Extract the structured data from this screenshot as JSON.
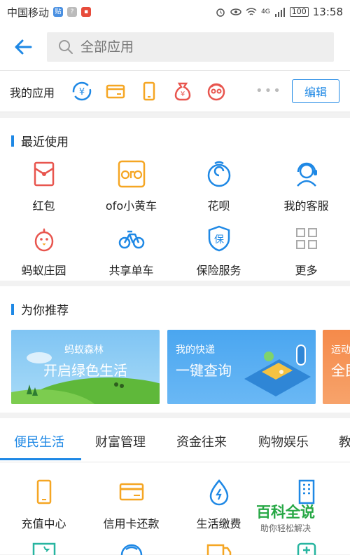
{
  "statusbar": {
    "carrier": "中国移动",
    "network": "4G",
    "battery": "100",
    "time": "13:58"
  },
  "search": {
    "placeholder": "全部应用"
  },
  "myapps": {
    "label": "我的应用",
    "more": "•••",
    "edit": "编辑",
    "icons": [
      "yuan-transfer-icon",
      "card-icon",
      "phone-icon",
      "money-bag-icon",
      "mascot-icon"
    ]
  },
  "recent": {
    "title": "最近使用",
    "items": [
      {
        "label": "红包",
        "icon": "red-packet-icon"
      },
      {
        "label": "ofo小黄车",
        "icon": "ofo-icon"
      },
      {
        "label": "花呗",
        "icon": "huabei-icon"
      },
      {
        "label": "我的客服",
        "icon": "customer-service-icon"
      },
      {
        "label": "蚂蚁庄园",
        "icon": "chick-icon"
      },
      {
        "label": "共享单车",
        "icon": "bicycle-icon"
      },
      {
        "label": "保险服务",
        "icon": "insurance-shield-icon"
      },
      {
        "label": "更多",
        "icon": "grid-more-icon"
      }
    ]
  },
  "recommend": {
    "title": "为你推荐",
    "cards": [
      {
        "title": "蚂蚁森林",
        "subtitle": "开启绿色生活"
      },
      {
        "title": "我的快递",
        "subtitle": "一键查询"
      },
      {
        "title": "运动",
        "subtitle": "全民"
      }
    ]
  },
  "tabs": [
    "便民生活",
    "财富管理",
    "资金往来",
    "购物娱乐",
    "教"
  ],
  "services": [
    {
      "label": "充值中心",
      "icon": "phone-recharge-icon"
    },
    {
      "label": "信用卡还款",
      "icon": "credit-card-icon"
    },
    {
      "label": "生活缴费",
      "icon": "utility-bill-icon"
    },
    {
      "label": "",
      "icon": "building-icon"
    }
  ],
  "watermark": {
    "title": "百科全说",
    "subtitle": "助你轻松解决"
  },
  "colors": {
    "accent": "#1e88e5",
    "orange": "#f5a623",
    "red": "#e8554e"
  }
}
